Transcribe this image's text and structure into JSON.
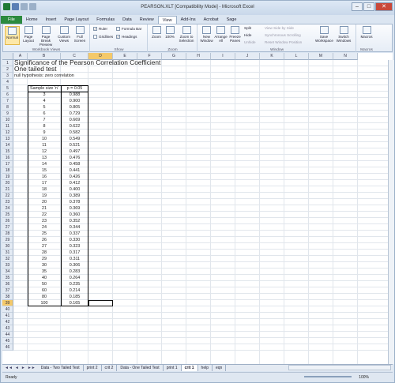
{
  "window": {
    "title": "PEARSON.XLT  [Compatibility Mode] - Microsoft Excel",
    "minimize": "–",
    "maximize": "□",
    "close": "✕"
  },
  "ribbon_tabs": [
    "File",
    "Home",
    "Insert",
    "Page Layout",
    "Formulas",
    "Data",
    "Review",
    "View",
    "Add-Ins",
    "Acrobat",
    "Sage"
  ],
  "active_tab": "View",
  "ribbon": {
    "workbook_views": {
      "label": "Workbook Views",
      "buttons": [
        "Normal",
        "Page Layout",
        "Page Break Preview",
        "Custom Views",
        "Full Screen"
      ]
    },
    "show": {
      "label": "Show",
      "ruler": "Ruler",
      "formula_bar": "Formula Bar",
      "gridlines": "Gridlines",
      "headings": "Headings"
    },
    "zoom": {
      "label": "Zoom",
      "buttons": [
        "Zoom",
        "100%",
        "Zoom to Selection"
      ]
    },
    "window": {
      "label": "Window",
      "buttons": [
        "New Window",
        "Arrange All",
        "Freeze Panes"
      ],
      "small": [
        "Split",
        "Hide",
        "Unhide"
      ],
      "small2": [
        "View Side by Side",
        "Synchronous Scrolling",
        "Reset Window Position"
      ],
      "save_workspace": "Save Workspace",
      "switch_windows": "Switch Windows"
    },
    "macros": {
      "label": "Macros",
      "button": "Macros"
    }
  },
  "columns": [
    "A",
    "B",
    "C",
    "D",
    "E",
    "F",
    "G",
    "H",
    "I",
    "J",
    "K",
    "L",
    "M",
    "N"
  ],
  "selected_column": "D",
  "rows": [
    "1",
    "2",
    "3",
    "4",
    "5",
    "6",
    "7",
    "8",
    "9",
    "10",
    "11",
    "12",
    "13",
    "14",
    "15",
    "16",
    "17",
    "18",
    "19",
    "20",
    "21",
    "22",
    "23",
    "24",
    "25",
    "26",
    "27",
    "28",
    "29",
    "30",
    "31",
    "32",
    "33",
    "34",
    "35",
    "36",
    "37",
    "38",
    "39",
    "40",
    "41",
    "42",
    "43",
    "44",
    "45",
    "46"
  ],
  "selected_row": "39",
  "sheet": {
    "title1": "Significance of the Pearson Correlation Coefficient",
    "title2": "One tailed test",
    "note": "null hypothesis: zero correlation",
    "table_headers": [
      "Sample size 'n'",
      "p = 0.05"
    ],
    "table_rows": [
      [
        "3",
        "0.988"
      ],
      [
        "4",
        "0.900"
      ],
      [
        "5",
        "0.805"
      ],
      [
        "6",
        "0.729"
      ],
      [
        "7",
        "0.669"
      ],
      [
        "8",
        "0.622"
      ],
      [
        "9",
        "0.582"
      ],
      [
        "10",
        "0.549"
      ],
      [
        "11",
        "0.521"
      ],
      [
        "12",
        "0.497"
      ],
      [
        "13",
        "0.476"
      ],
      [
        "14",
        "0.458"
      ],
      [
        "15",
        "0.441"
      ],
      [
        "16",
        "0.426"
      ],
      [
        "17",
        "0.412"
      ],
      [
        "18",
        "0.400"
      ],
      [
        "19",
        "0.389"
      ],
      [
        "20",
        "0.378"
      ],
      [
        "21",
        "0.369"
      ],
      [
        "22",
        "0.360"
      ],
      [
        "23",
        "0.352"
      ],
      [
        "24",
        "0.344"
      ],
      [
        "25",
        "0.337"
      ],
      [
        "26",
        "0.330"
      ],
      [
        "27",
        "0.323"
      ],
      [
        "28",
        "0.317"
      ],
      [
        "29",
        "0.311"
      ],
      [
        "30",
        "0.306"
      ],
      [
        "35",
        "0.283"
      ],
      [
        "40",
        "0.264"
      ],
      [
        "50",
        "0.235"
      ],
      [
        "60",
        "0.214"
      ],
      [
        "80",
        "0.185"
      ],
      [
        "100",
        "0.165"
      ]
    ]
  },
  "sheet_tabs": [
    "Data - Two Tailed Test",
    "print 2",
    "crit 2",
    "Data - One Tailed Test",
    "print 1",
    "crit 1",
    "help",
    "eqn"
  ],
  "active_sheet": "crit 1",
  "status": {
    "ready": "Ready",
    "zoom": "100%"
  }
}
